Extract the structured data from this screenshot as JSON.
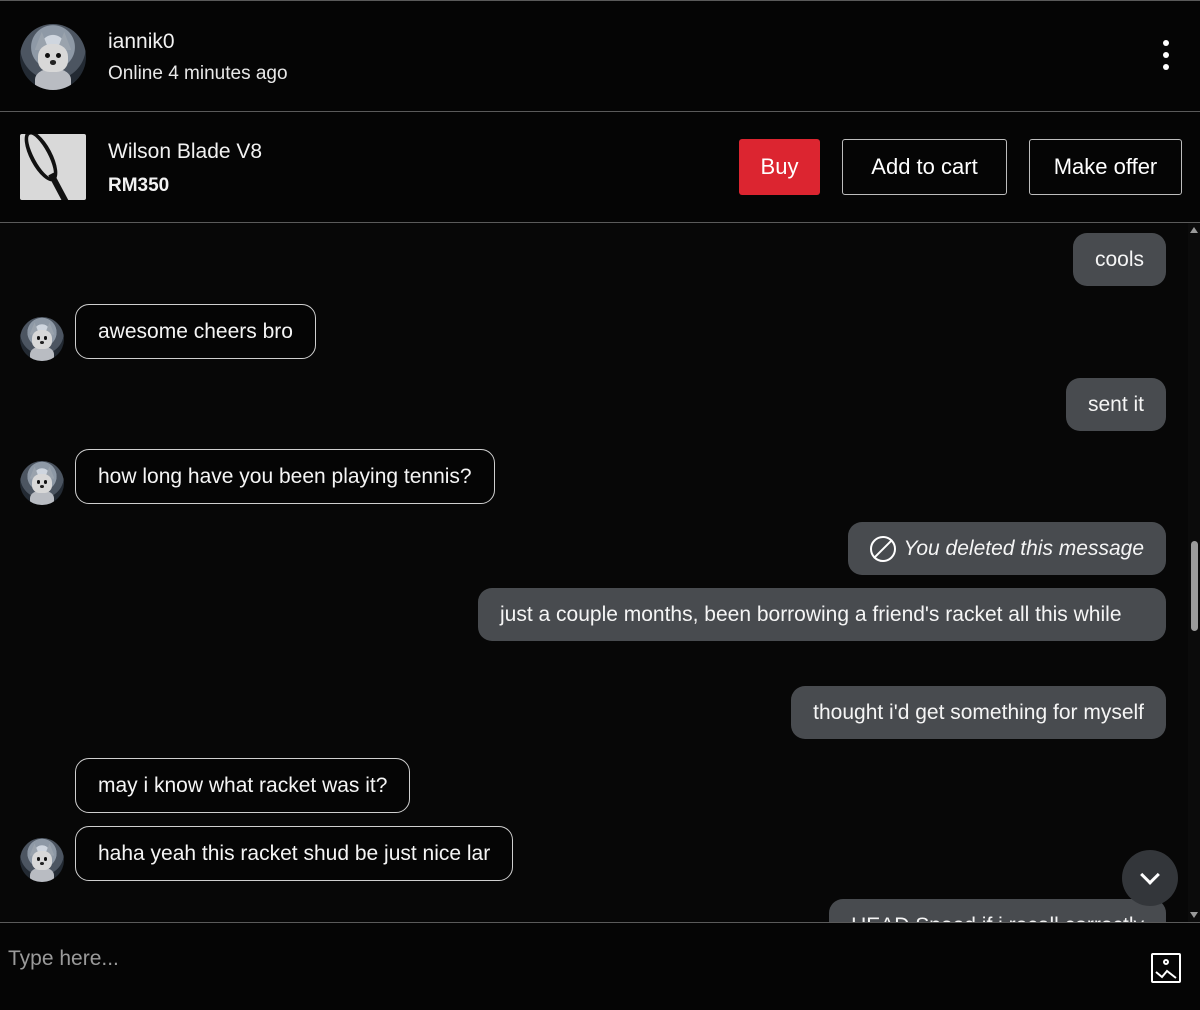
{
  "header": {
    "username": "iannik0",
    "status": "Online 4 minutes ago",
    "menu_icon": "more-vertical-icon"
  },
  "product": {
    "title": "Wilson Blade V8",
    "price": "RM350",
    "buy_label": "Buy",
    "add_to_cart_label": "Add to cart",
    "make_offer_label": "Make offer",
    "buy_color": "#dc2530"
  },
  "messages": [
    {
      "direction": "out",
      "text": "cools"
    },
    {
      "direction": "in",
      "text": "awesome cheers bro"
    },
    {
      "direction": "out",
      "text": "sent it"
    },
    {
      "direction": "in",
      "text": "how long have you been playing tennis?"
    },
    {
      "direction": "out",
      "text": "You deleted this message",
      "deleted": true
    },
    {
      "direction": "out",
      "text": "just a couple months, been borrowing a friend's racket all this while"
    },
    {
      "direction": "out",
      "text": "thought i'd get something for myself"
    },
    {
      "direction": "in",
      "text": "may i know what racket was it?"
    },
    {
      "direction": "in",
      "text": "haha yeah this racket shud be just nice lar"
    },
    {
      "direction": "out",
      "text": "HEAD Speed if i recall correctly"
    }
  ],
  "composer": {
    "placeholder": "Type here...",
    "attach_icon": "image-upload-icon"
  },
  "colors": {
    "background": "#070707",
    "outgoing_bubble": "#484b4f",
    "incoming_border": "#cfcfcf"
  }
}
